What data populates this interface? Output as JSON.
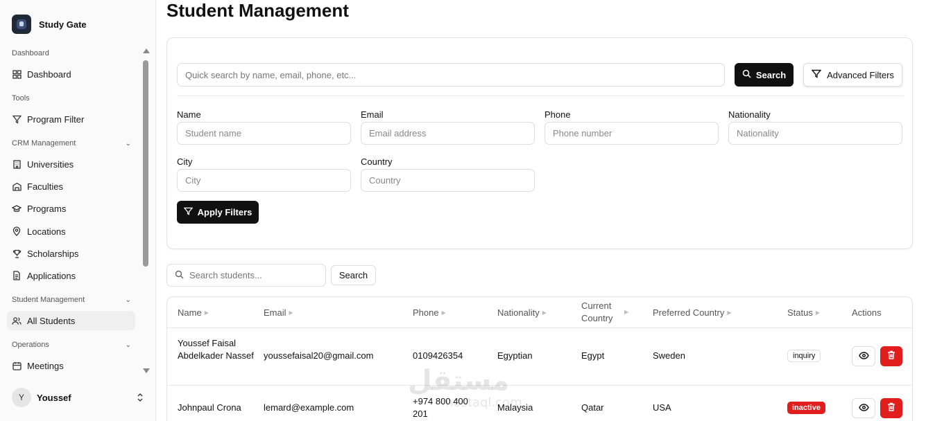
{
  "brand": {
    "name": "Study Gate"
  },
  "sidebar": {
    "sections": [
      {
        "label": "Dashboard"
      },
      {
        "label": "Tools"
      },
      {
        "label": "CRM Management"
      },
      {
        "label": "Student Management"
      },
      {
        "label": "Operations"
      }
    ],
    "items": [
      {
        "label": "Dashboard",
        "icon": "grid-icon"
      },
      {
        "label": "Program Filter",
        "icon": "filter-icon"
      },
      {
        "label": "Universities",
        "icon": "building-icon"
      },
      {
        "label": "Faculties",
        "icon": "faculty-icon"
      },
      {
        "label": "Programs",
        "icon": "graduation-cap-icon"
      },
      {
        "label": "Locations",
        "icon": "map-pin-icon"
      },
      {
        "label": "Scholarships",
        "icon": "trophy-icon"
      },
      {
        "label": "Applications",
        "icon": "file-icon"
      },
      {
        "label": "All Students",
        "icon": "users-icon",
        "active": true
      },
      {
        "label": "Meetings",
        "icon": "calendar-icon"
      }
    ],
    "user": {
      "initial": "Y",
      "name": "Youssef"
    }
  },
  "page": {
    "title": "Student Management"
  },
  "filters": {
    "quick_search_placeholder": "Quick search by name, email, phone, etc...",
    "search_label": "Search",
    "advanced_label": "Advanced Filters",
    "fields": [
      {
        "label": "Name",
        "placeholder": "Student name"
      },
      {
        "label": "Email",
        "placeholder": "Email address"
      },
      {
        "label": "Phone",
        "placeholder": "Phone number"
      },
      {
        "label": "Nationality",
        "placeholder": "Nationality"
      },
      {
        "label": "City",
        "placeholder": "City"
      },
      {
        "label": "Country",
        "placeholder": "Country"
      }
    ],
    "apply_label": "Apply Filters"
  },
  "table_search": {
    "placeholder": "Search students...",
    "button_label": "Search"
  },
  "table": {
    "headers": [
      "Name",
      "Email",
      "Phone",
      "Nationality",
      "Current Country",
      "Preferred Country",
      "Status",
      "Actions"
    ],
    "rows": [
      {
        "name": "Youssef Faisal Abdelkader Nassef",
        "email": "youssefaisal20@gmail.com",
        "phone": "0109426354",
        "nationality": "Egyptian",
        "current_country": "Egypt",
        "preferred_country": "Sweden",
        "status": "inquiry"
      },
      {
        "name": "Johnpaul Crona",
        "email": "lemard@example.com",
        "phone": "+974 800 400 201",
        "nationality": "Malaysia",
        "current_country": "Qatar",
        "preferred_country": "USA",
        "status": "inactive"
      }
    ]
  },
  "watermark": {
    "text": "مستقل",
    "sub": "mostaql.com"
  },
  "colors": {
    "primary": "#111111",
    "danger": "#e11d1d",
    "active_bg": "#efefef"
  }
}
